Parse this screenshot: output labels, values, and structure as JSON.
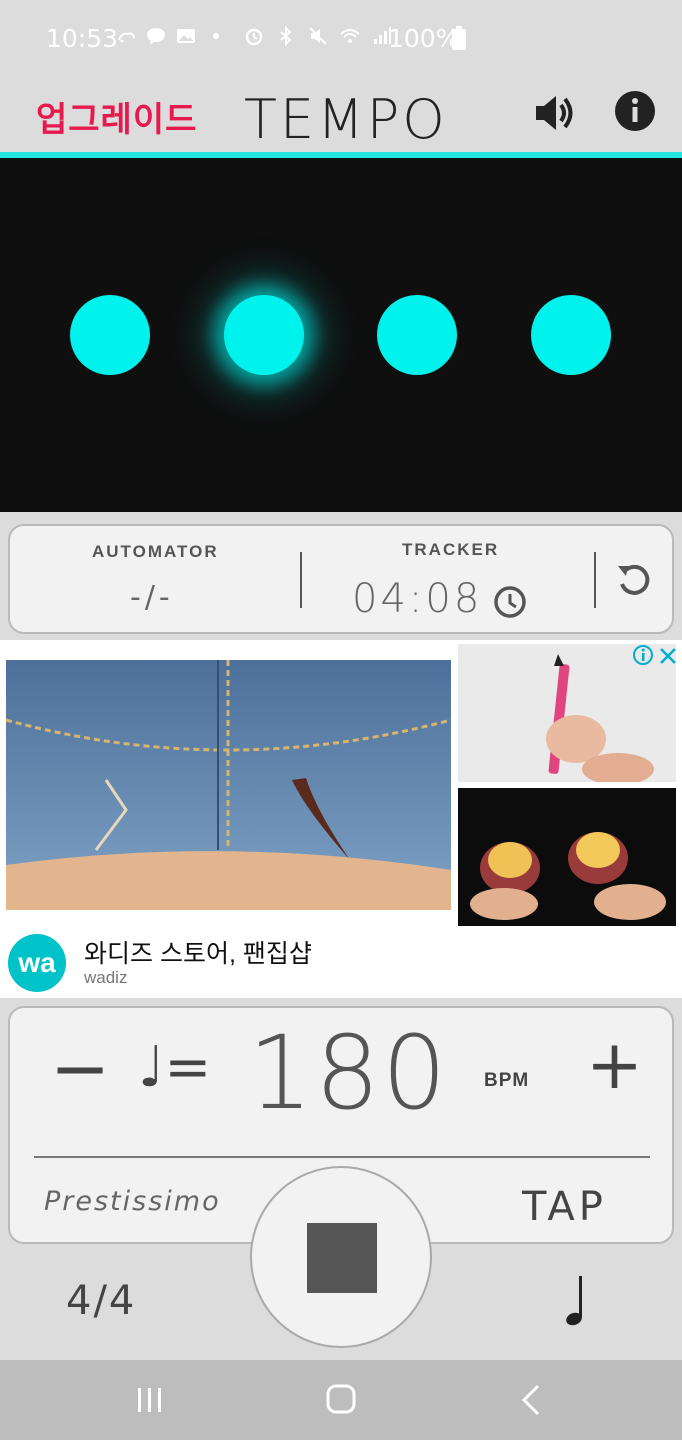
{
  "status_bar": {
    "time": "10:53",
    "battery": "100%",
    "icons": [
      "weather-icon",
      "talk-icon",
      "gallery-icon",
      "dot-icon",
      "alarm-icon",
      "bluetooth-icon",
      "mute-icon",
      "wifi-icon",
      "signal-icon",
      "battery-icon"
    ]
  },
  "header": {
    "upgrade_label": "업그레이드",
    "title": "TEMPO",
    "sound_icon": "speaker-icon",
    "info_icon": "info-icon",
    "accent": "#24e4e1"
  },
  "beats": {
    "count": 4,
    "active_index": 1,
    "color": "#00f2ec"
  },
  "tracker_card": {
    "automator_label": "AUTOMATOR",
    "automator_value": "-/-",
    "tracker_label": "TRACKER",
    "tracker_value": "04:08",
    "clock_icon": "clock-icon",
    "reset_icon": "reset-icon"
  },
  "ad": {
    "title": "와디즈 스토어, 팬집샵",
    "advertiser": "wadiz",
    "logo_text": "wa",
    "info_icon": "ad-info-icon",
    "close_icon": "ad-close-icon"
  },
  "tempo_card": {
    "minus_label": "−",
    "note_equals": "♩=",
    "bpm": "180",
    "bpm_label": "BPM",
    "plus_label": "+",
    "tempo_name": "Prestissimo",
    "tap_label": "TAP"
  },
  "controls": {
    "stop_icon": "stop-icon",
    "time_signature": "4/4",
    "subdivision_icon": "quarter-note-icon"
  },
  "navbar": {
    "icons": [
      "recent-apps-icon",
      "home-icon",
      "back-icon"
    ]
  }
}
